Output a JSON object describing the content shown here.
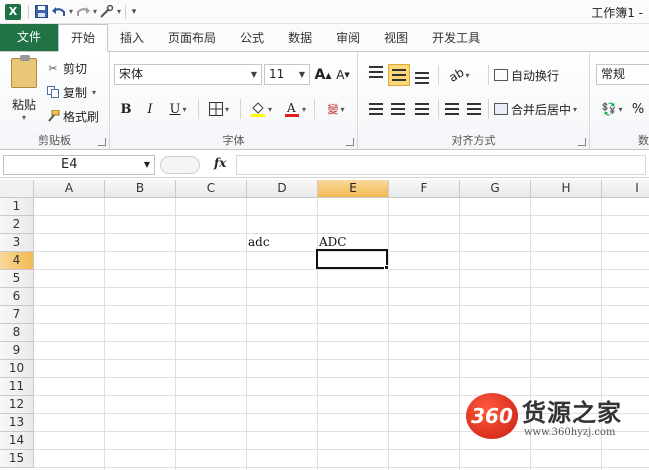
{
  "window": {
    "title": "工作簿1 -"
  },
  "quick_access": {
    "app_icon": "X",
    "save": "save-icon",
    "undo": "undo-icon",
    "redo": "redo-icon",
    "custom": "customize-icon"
  },
  "tabs": [
    {
      "label": "文件"
    },
    {
      "label": "开始"
    },
    {
      "label": "插入"
    },
    {
      "label": "页面布局"
    },
    {
      "label": "公式"
    },
    {
      "label": "数据"
    },
    {
      "label": "审阅"
    },
    {
      "label": "视图"
    },
    {
      "label": "开发工具"
    }
  ],
  "clipboard": {
    "paste": "粘贴",
    "cut": "剪切",
    "copy": "复制",
    "format_painter": "格式刷",
    "group": "剪贴板"
  },
  "font": {
    "name": "宋体",
    "size": "11",
    "grow": "A",
    "shrink": "A",
    "bold": "B",
    "italic": "I",
    "underline": "U",
    "phonetic": "wén",
    "group": "字体"
  },
  "alignment": {
    "wrap_text": "自动换行",
    "merge_center": "合并后居中",
    "group": "对齐方式"
  },
  "number": {
    "format": "常规",
    "percent": "%",
    "group": "数"
  },
  "formula_bar": {
    "name_box": "E4",
    "fx": "fx",
    "value": ""
  },
  "columns": [
    "A",
    "B",
    "C",
    "D",
    "E",
    "F",
    "G",
    "H",
    "I"
  ],
  "rows": [
    "1",
    "2",
    "3",
    "4",
    "5",
    "6",
    "7",
    "8",
    "9",
    "10",
    "11",
    "12",
    "13",
    "14",
    "15"
  ],
  "cells": {
    "D3": "adc",
    "E3": "ADC"
  },
  "selection": {
    "column": "E",
    "row": "4"
  },
  "watermark": {
    "logo": "360",
    "title": "货源之家",
    "url": "www.360hyzj.com"
  }
}
